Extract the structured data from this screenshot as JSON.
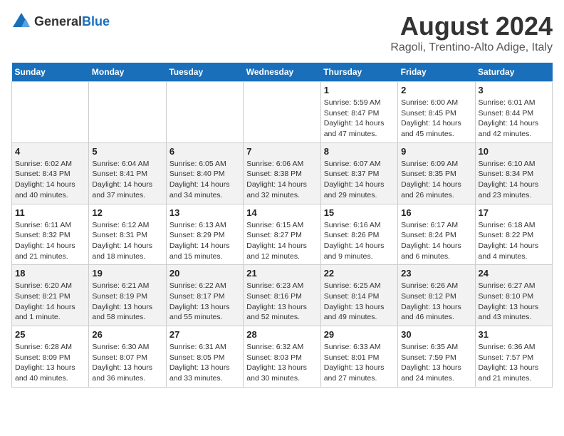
{
  "logo": {
    "general": "General",
    "blue": "Blue"
  },
  "title": "August 2024",
  "subtitle": "Ragoli, Trentino-Alto Adige, Italy",
  "headers": [
    "Sunday",
    "Monday",
    "Tuesday",
    "Wednesday",
    "Thursday",
    "Friday",
    "Saturday"
  ],
  "weeks": [
    [
      {
        "day": "",
        "info": ""
      },
      {
        "day": "",
        "info": ""
      },
      {
        "day": "",
        "info": ""
      },
      {
        "day": "",
        "info": ""
      },
      {
        "day": "1",
        "info": "Sunrise: 5:59 AM\nSunset: 8:47 PM\nDaylight: 14 hours and 47 minutes."
      },
      {
        "day": "2",
        "info": "Sunrise: 6:00 AM\nSunset: 8:45 PM\nDaylight: 14 hours and 45 minutes."
      },
      {
        "day": "3",
        "info": "Sunrise: 6:01 AM\nSunset: 8:44 PM\nDaylight: 14 hours and 42 minutes."
      }
    ],
    [
      {
        "day": "4",
        "info": "Sunrise: 6:02 AM\nSunset: 8:43 PM\nDaylight: 14 hours and 40 minutes."
      },
      {
        "day": "5",
        "info": "Sunrise: 6:04 AM\nSunset: 8:41 PM\nDaylight: 14 hours and 37 minutes."
      },
      {
        "day": "6",
        "info": "Sunrise: 6:05 AM\nSunset: 8:40 PM\nDaylight: 14 hours and 34 minutes."
      },
      {
        "day": "7",
        "info": "Sunrise: 6:06 AM\nSunset: 8:38 PM\nDaylight: 14 hours and 32 minutes."
      },
      {
        "day": "8",
        "info": "Sunrise: 6:07 AM\nSunset: 8:37 PM\nDaylight: 14 hours and 29 minutes."
      },
      {
        "day": "9",
        "info": "Sunrise: 6:09 AM\nSunset: 8:35 PM\nDaylight: 14 hours and 26 minutes."
      },
      {
        "day": "10",
        "info": "Sunrise: 6:10 AM\nSunset: 8:34 PM\nDaylight: 14 hours and 23 minutes."
      }
    ],
    [
      {
        "day": "11",
        "info": "Sunrise: 6:11 AM\nSunset: 8:32 PM\nDaylight: 14 hours and 21 minutes."
      },
      {
        "day": "12",
        "info": "Sunrise: 6:12 AM\nSunset: 8:31 PM\nDaylight: 14 hours and 18 minutes."
      },
      {
        "day": "13",
        "info": "Sunrise: 6:13 AM\nSunset: 8:29 PM\nDaylight: 14 hours and 15 minutes."
      },
      {
        "day": "14",
        "info": "Sunrise: 6:15 AM\nSunset: 8:27 PM\nDaylight: 14 hours and 12 minutes."
      },
      {
        "day": "15",
        "info": "Sunrise: 6:16 AM\nSunset: 8:26 PM\nDaylight: 14 hours and 9 minutes."
      },
      {
        "day": "16",
        "info": "Sunrise: 6:17 AM\nSunset: 8:24 PM\nDaylight: 14 hours and 6 minutes."
      },
      {
        "day": "17",
        "info": "Sunrise: 6:18 AM\nSunset: 8:22 PM\nDaylight: 14 hours and 4 minutes."
      }
    ],
    [
      {
        "day": "18",
        "info": "Sunrise: 6:20 AM\nSunset: 8:21 PM\nDaylight: 14 hours and 1 minute."
      },
      {
        "day": "19",
        "info": "Sunrise: 6:21 AM\nSunset: 8:19 PM\nDaylight: 13 hours and 58 minutes."
      },
      {
        "day": "20",
        "info": "Sunrise: 6:22 AM\nSunset: 8:17 PM\nDaylight: 13 hours and 55 minutes."
      },
      {
        "day": "21",
        "info": "Sunrise: 6:23 AM\nSunset: 8:16 PM\nDaylight: 13 hours and 52 minutes."
      },
      {
        "day": "22",
        "info": "Sunrise: 6:25 AM\nSunset: 8:14 PM\nDaylight: 13 hours and 49 minutes."
      },
      {
        "day": "23",
        "info": "Sunrise: 6:26 AM\nSunset: 8:12 PM\nDaylight: 13 hours and 46 minutes."
      },
      {
        "day": "24",
        "info": "Sunrise: 6:27 AM\nSunset: 8:10 PM\nDaylight: 13 hours and 43 minutes."
      }
    ],
    [
      {
        "day": "25",
        "info": "Sunrise: 6:28 AM\nSunset: 8:09 PM\nDaylight: 13 hours and 40 minutes."
      },
      {
        "day": "26",
        "info": "Sunrise: 6:30 AM\nSunset: 8:07 PM\nDaylight: 13 hours and 36 minutes."
      },
      {
        "day": "27",
        "info": "Sunrise: 6:31 AM\nSunset: 8:05 PM\nDaylight: 13 hours and 33 minutes."
      },
      {
        "day": "28",
        "info": "Sunrise: 6:32 AM\nSunset: 8:03 PM\nDaylight: 13 hours and 30 minutes."
      },
      {
        "day": "29",
        "info": "Sunrise: 6:33 AM\nSunset: 8:01 PM\nDaylight: 13 hours and 27 minutes."
      },
      {
        "day": "30",
        "info": "Sunrise: 6:35 AM\nSunset: 7:59 PM\nDaylight: 13 hours and 24 minutes."
      },
      {
        "day": "31",
        "info": "Sunrise: 6:36 AM\nSunset: 7:57 PM\nDaylight: 13 hours and 21 minutes."
      }
    ]
  ]
}
